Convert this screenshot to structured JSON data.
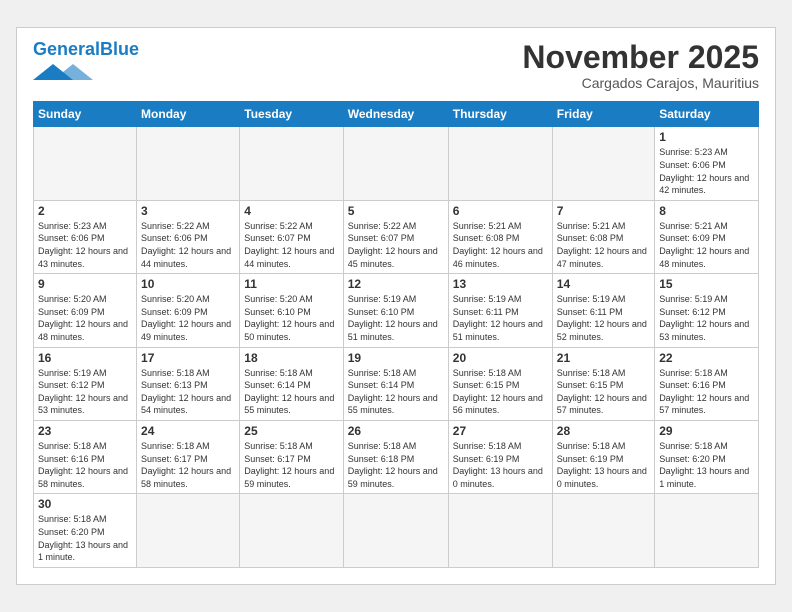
{
  "header": {
    "logo": {
      "part1": "General",
      "part2": "Blue"
    },
    "title": "November 2025",
    "location": "Cargados Carajos, Mauritius"
  },
  "days_of_week": [
    "Sunday",
    "Monday",
    "Tuesday",
    "Wednesday",
    "Thursday",
    "Friday",
    "Saturday"
  ],
  "weeks": [
    [
      {
        "day": "",
        "info": ""
      },
      {
        "day": "",
        "info": ""
      },
      {
        "day": "",
        "info": ""
      },
      {
        "day": "",
        "info": ""
      },
      {
        "day": "",
        "info": ""
      },
      {
        "day": "",
        "info": ""
      },
      {
        "day": "1",
        "info": "Sunrise: 5:23 AM\nSunset: 6:06 PM\nDaylight: 12 hours\nand 42 minutes."
      }
    ],
    [
      {
        "day": "2",
        "info": "Sunrise: 5:23 AM\nSunset: 6:06 PM\nDaylight: 12 hours\nand 43 minutes."
      },
      {
        "day": "3",
        "info": "Sunrise: 5:22 AM\nSunset: 6:06 PM\nDaylight: 12 hours\nand 44 minutes."
      },
      {
        "day": "4",
        "info": "Sunrise: 5:22 AM\nSunset: 6:07 PM\nDaylight: 12 hours\nand 44 minutes."
      },
      {
        "day": "5",
        "info": "Sunrise: 5:22 AM\nSunset: 6:07 PM\nDaylight: 12 hours\nand 45 minutes."
      },
      {
        "day": "6",
        "info": "Sunrise: 5:21 AM\nSunset: 6:08 PM\nDaylight: 12 hours\nand 46 minutes."
      },
      {
        "day": "7",
        "info": "Sunrise: 5:21 AM\nSunset: 6:08 PM\nDaylight: 12 hours\nand 47 minutes."
      },
      {
        "day": "8",
        "info": "Sunrise: 5:21 AM\nSunset: 6:09 PM\nDaylight: 12 hours\nand 48 minutes."
      }
    ],
    [
      {
        "day": "9",
        "info": "Sunrise: 5:20 AM\nSunset: 6:09 PM\nDaylight: 12 hours\nand 48 minutes."
      },
      {
        "day": "10",
        "info": "Sunrise: 5:20 AM\nSunset: 6:09 PM\nDaylight: 12 hours\nand 49 minutes."
      },
      {
        "day": "11",
        "info": "Sunrise: 5:20 AM\nSunset: 6:10 PM\nDaylight: 12 hours\nand 50 minutes."
      },
      {
        "day": "12",
        "info": "Sunrise: 5:19 AM\nSunset: 6:10 PM\nDaylight: 12 hours\nand 51 minutes."
      },
      {
        "day": "13",
        "info": "Sunrise: 5:19 AM\nSunset: 6:11 PM\nDaylight: 12 hours\nand 51 minutes."
      },
      {
        "day": "14",
        "info": "Sunrise: 5:19 AM\nSunset: 6:11 PM\nDaylight: 12 hours\nand 52 minutes."
      },
      {
        "day": "15",
        "info": "Sunrise: 5:19 AM\nSunset: 6:12 PM\nDaylight: 12 hours\nand 53 minutes."
      }
    ],
    [
      {
        "day": "16",
        "info": "Sunrise: 5:19 AM\nSunset: 6:12 PM\nDaylight: 12 hours\nand 53 minutes."
      },
      {
        "day": "17",
        "info": "Sunrise: 5:18 AM\nSunset: 6:13 PM\nDaylight: 12 hours\nand 54 minutes."
      },
      {
        "day": "18",
        "info": "Sunrise: 5:18 AM\nSunset: 6:14 PM\nDaylight: 12 hours\nand 55 minutes."
      },
      {
        "day": "19",
        "info": "Sunrise: 5:18 AM\nSunset: 6:14 PM\nDaylight: 12 hours\nand 55 minutes."
      },
      {
        "day": "20",
        "info": "Sunrise: 5:18 AM\nSunset: 6:15 PM\nDaylight: 12 hours\nand 56 minutes."
      },
      {
        "day": "21",
        "info": "Sunrise: 5:18 AM\nSunset: 6:15 PM\nDaylight: 12 hours\nand 57 minutes."
      },
      {
        "day": "22",
        "info": "Sunrise: 5:18 AM\nSunset: 6:16 PM\nDaylight: 12 hours\nand 57 minutes."
      }
    ],
    [
      {
        "day": "23",
        "info": "Sunrise: 5:18 AM\nSunset: 6:16 PM\nDaylight: 12 hours\nand 58 minutes."
      },
      {
        "day": "24",
        "info": "Sunrise: 5:18 AM\nSunset: 6:17 PM\nDaylight: 12 hours\nand 58 minutes."
      },
      {
        "day": "25",
        "info": "Sunrise: 5:18 AM\nSunset: 6:17 PM\nDaylight: 12 hours\nand 59 minutes."
      },
      {
        "day": "26",
        "info": "Sunrise: 5:18 AM\nSunset: 6:18 PM\nDaylight: 12 hours\nand 59 minutes."
      },
      {
        "day": "27",
        "info": "Sunrise: 5:18 AM\nSunset: 6:19 PM\nDaylight: 13 hours\nand 0 minutes."
      },
      {
        "day": "28",
        "info": "Sunrise: 5:18 AM\nSunset: 6:19 PM\nDaylight: 13 hours\nand 0 minutes."
      },
      {
        "day": "29",
        "info": "Sunrise: 5:18 AM\nSunset: 6:20 PM\nDaylight: 13 hours\nand 1 minute."
      }
    ],
    [
      {
        "day": "30",
        "info": "Sunrise: 5:18 AM\nSunset: 6:20 PM\nDaylight: 13 hours\nand 1 minute."
      },
      {
        "day": "",
        "info": ""
      },
      {
        "day": "",
        "info": ""
      },
      {
        "day": "",
        "info": ""
      },
      {
        "day": "",
        "info": ""
      },
      {
        "day": "",
        "info": ""
      },
      {
        "day": "",
        "info": ""
      }
    ]
  ]
}
